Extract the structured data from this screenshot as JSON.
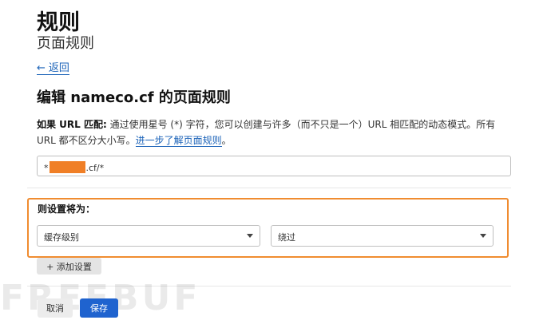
{
  "header": {
    "title": "规则",
    "subtitle": "页面规则"
  },
  "back_link": {
    "label": "返回"
  },
  "editor": {
    "heading": "编辑 nameco.cf 的页面规则",
    "desc_label": "如果 URL 匹配:",
    "desc_text": " 通过使用星号 (*) 字符，您可以创建与许多（而不只是一个）URL 相匹配的动态模式。所有 URL 都不区分大小写。",
    "desc_link": "进一步了解页面规则",
    "desc_end": "。",
    "url_prefix": "*",
    "url_suffix": ".cf/*"
  },
  "settings": {
    "label": "则设置将为：",
    "setting_select": "缓存级别",
    "value_select": "绕过",
    "add_button": "+ 添加设置"
  },
  "footer": {
    "cancel_label": "取消",
    "save_label": "保存"
  },
  "watermark": "FREEBUF",
  "colors": {
    "accent": "#1f63cf",
    "highlight": "#f08c30",
    "redaction": "#f07f26"
  }
}
